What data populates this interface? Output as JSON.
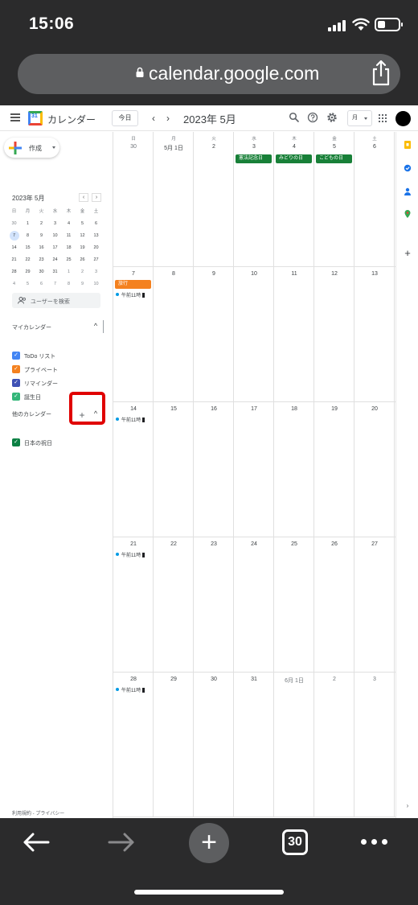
{
  "status_bar": {
    "time": "15:06"
  },
  "browser": {
    "url": "calendar.google.com",
    "tab_count": "30"
  },
  "header": {
    "app_title": "カレンダー",
    "logo_day": "31",
    "today_label": "今日",
    "prev": "‹",
    "next": "›",
    "month_title": "2023年 5月",
    "view_label": "月"
  },
  "sidebar": {
    "create_label": "作成",
    "mini_cal": {
      "title": "2023年 5月",
      "prev": "‹",
      "next": "›",
      "weekdays": [
        "日",
        "月",
        "火",
        "水",
        "木",
        "金",
        "土"
      ],
      "weeks": [
        [
          "30",
          "1",
          "2",
          "3",
          "4",
          "5",
          "6"
        ],
        [
          "7",
          "8",
          "9",
          "10",
          "11",
          "12",
          "13"
        ],
        [
          "14",
          "15",
          "16",
          "17",
          "18",
          "19",
          "20"
        ],
        [
          "21",
          "22",
          "23",
          "24",
          "25",
          "26",
          "27"
        ],
        [
          "28",
          "29",
          "30",
          "31",
          "1",
          "2",
          "3"
        ],
        [
          "4",
          "5",
          "6",
          "7",
          "8",
          "9",
          "10"
        ]
      ]
    },
    "search_people_placeholder": "ユーザーを検索",
    "my_calendars_label": "マイカレンダー",
    "my_calendars": [
      {
        "label": "ToDo リスト",
        "color": "#4285f4"
      },
      {
        "label": "プライベート",
        "color": "#f4811f"
      },
      {
        "label": "リマインダー",
        "color": "#3f51b5"
      },
      {
        "label": "誕生日",
        "color": "#33b679"
      }
    ],
    "other_calendars_label": "他のカレンダー",
    "other_calendars": [
      {
        "label": "日本の祝日",
        "color": "#0b8043"
      }
    ],
    "footer": "利用規約 - プライバシー"
  },
  "month_grid": {
    "weekdays": [
      "日",
      "月",
      "火",
      "水",
      "木",
      "金",
      "土"
    ],
    "weeks": [
      [
        "30",
        "5月 1日",
        "2",
        "3",
        "4",
        "5",
        "6"
      ],
      [
        "7",
        "8",
        "9",
        "10",
        "11",
        "12",
        "13"
      ],
      [
        "14",
        "15",
        "16",
        "17",
        "18",
        "19",
        "20"
      ],
      [
        "21",
        "22",
        "23",
        "24",
        "25",
        "26",
        "27"
      ],
      [
        "28",
        "29",
        "30",
        "31",
        "6月 1日",
        "2",
        "3"
      ]
    ],
    "holidays": [
      {
        "week": 0,
        "day": 3,
        "label": "憲法記念日"
      },
      {
        "week": 0,
        "day": 4,
        "label": "みどりの日"
      },
      {
        "week": 0,
        "day": 5,
        "label": "こどもの日"
      }
    ],
    "allday_events": [
      {
        "week": 1,
        "day": 0,
        "label": "旅行",
        "color": "#f4811f"
      }
    ],
    "timed_events": [
      {
        "week": 1,
        "day": 0,
        "label": "午前11時"
      },
      {
        "week": 2,
        "day": 0,
        "label": "午前11時"
      },
      {
        "week": 3,
        "day": 0,
        "label": "午前11時"
      },
      {
        "week": 4,
        "day": 0,
        "label": "午前11時"
      }
    ]
  }
}
